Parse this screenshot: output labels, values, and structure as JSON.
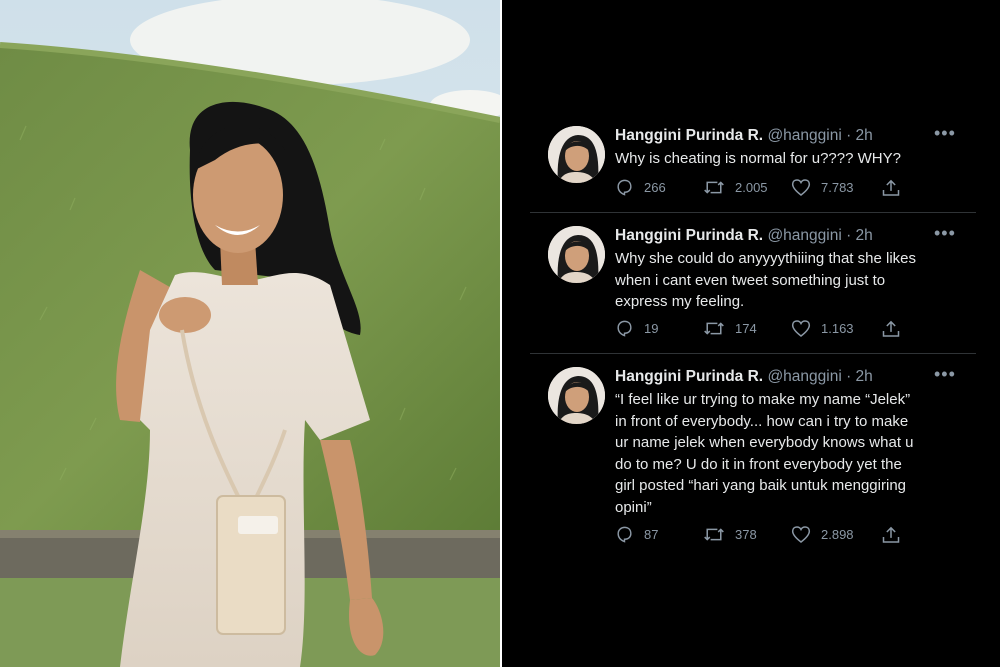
{
  "photo": {
    "description_icon": "photo-of-woman-on-grassy-hill"
  },
  "feed": {
    "tweets": [
      {
        "name": "Hanggini Purinda R.",
        "handle": "@hanggini · 2h",
        "text": "Why is cheating is normal for u???? WHY?",
        "replies": "266",
        "retweets": "2.005",
        "likes": "7.783"
      },
      {
        "name": "Hanggini Purinda R.",
        "handle": "@hanggini · 2h",
        "text": "Why  she could do anyyyythiiing that she likes\nwhen i cant even tweet something just to\nexpress my feeling.",
        "replies": "19",
        "retweets": "174",
        "likes": "1.163"
      },
      {
        "name": "Hanggini Purinda R.",
        "handle": "@hanggini · 2h",
        "text": "“I feel like ur trying to make my name “Jelek”\nin front of everybody... how can i try to make\nur name jelek when everybody knows what u\ndo to me? U do it in front everybody yet the\ngirl posted “hari yang baik untuk menggiring\nopini”",
        "replies": "87",
        "retweets": "378",
        "likes": "2.898"
      }
    ],
    "more_glyph": "•••"
  },
  "colors": {
    "background": "#000000",
    "text": "#e7e9ea",
    "muted": "#8b98a5",
    "divider": "#2f3336"
  }
}
